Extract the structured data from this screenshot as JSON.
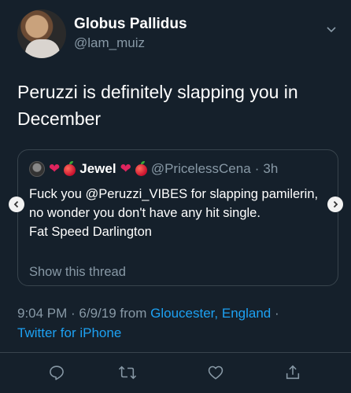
{
  "author": {
    "display_name": "Globus Pallidus",
    "handle": "@lam_muiz"
  },
  "tweet": {
    "text": "Peruzzi is definitely slapping you in December"
  },
  "quoted_tweet": {
    "name": "Jewel",
    "handle": "@PricelessCena",
    "separator": "·",
    "time": "3h",
    "text_line_1": "Fuck you @Peruzzi_VIBES for slapping pamilerin,  no wonder you don't have any hit single.",
    "text_line_2": "Fat Speed Darlington",
    "show_thread": "Show this thread",
    "name_emojis": [
      "heart",
      "apple"
    ],
    "trail_emojis": [
      "heart",
      "apple"
    ]
  },
  "meta": {
    "time": "9:04 PM · 6/9/19 from ",
    "location": "Gloucester, England",
    "sep": " ·",
    "client": "Twitter for iPhone"
  },
  "actions": [
    "reply-icon",
    "retweet-icon",
    "like-icon",
    "share-icon"
  ],
  "colors": {
    "background": "#15202b",
    "accent": "#1da1f2",
    "muted": "#8899a6",
    "border": "#38444d",
    "heart": "#e0245e"
  }
}
